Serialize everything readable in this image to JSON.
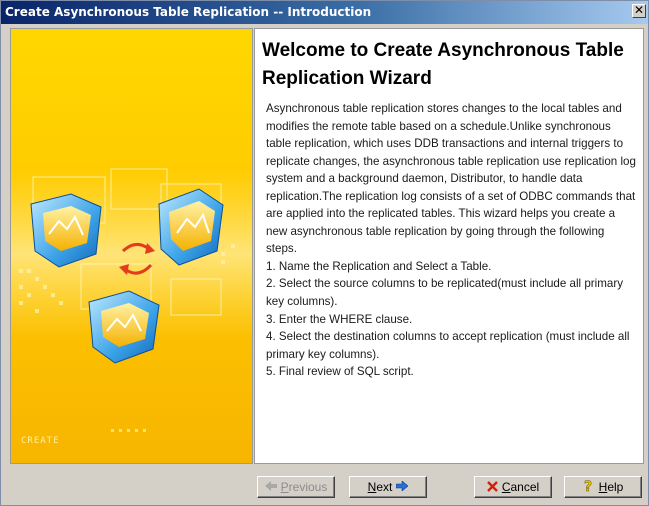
{
  "window": {
    "title": "Create Asynchronous Table Replication -- Introduction",
    "close_glyph": "✕"
  },
  "sidebar": {
    "illustration": "replication-illustration",
    "wordmark": "CREATE"
  },
  "main": {
    "heading": "Welcome to Create Asynchronous Table Replication Wizard",
    "description": "Asynchronous table replication stores changes to the local tables and modifies the remote table based on a schedule.Unlike synchronous table replication, which uses DDB transactions and internal triggers to replicate changes, the asynchronous table replication use replication log system and a background daemon, Distributor, to handle data replication.The replication log consists of a set of ODBC commands that are applied into the replicated tables. This wizard helps you create a new asynchronous table replication by going through the following steps.",
    "steps": [
      "1. Name the Replication and Select a Table.",
      "2. Select the source columns to be replicated(must include all primary key columns).",
      "3. Enter the WHERE clause.",
      "4. Select the destination columns to accept replication (must include all primary key columns).",
      "5. Final review of SQL script."
    ]
  },
  "buttons": {
    "previous": {
      "mnemonic": "P",
      "rest": "revious",
      "icon": "arrow-left-icon",
      "enabled": false
    },
    "next": {
      "mnemonic": "N",
      "rest": "ext",
      "icon": "arrow-right-icon",
      "enabled": true
    },
    "cancel": {
      "mnemonic": "C",
      "rest": "ancel",
      "icon": "red-x-icon",
      "enabled": true
    },
    "help": {
      "mnemonic": "H",
      "rest": "elp",
      "icon": "question-mark-icon",
      "enabled": true
    }
  },
  "colors": {
    "title_bar_start": "#0a246a",
    "sidebar_yellow": "#ffc800",
    "dialog_gray": "#d4d0c8"
  }
}
